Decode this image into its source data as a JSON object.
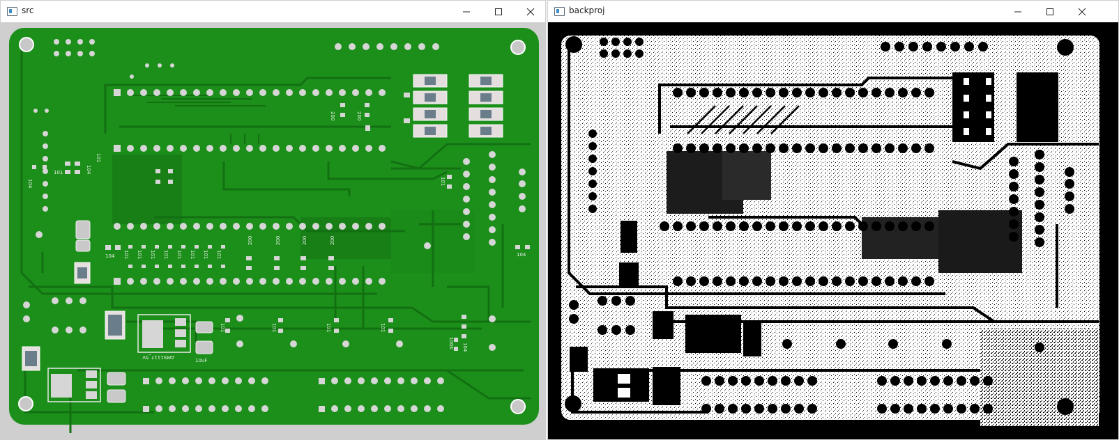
{
  "windows": {
    "src": {
      "title": "src",
      "silkscreen": {
        "cap1": "104",
        "cap2": "104",
        "cap3": "101",
        "cap4": "104",
        "res_row": [
          "101",
          "101",
          "101",
          "101",
          "101",
          "101",
          "101",
          "101"
        ],
        "res200": [
          "200",
          "200",
          "200",
          "200"
        ],
        "reg": "AMS1117_5V",
        "cap10u": "10uF",
        "cap_r1": "101",
        "cap_r2": "101",
        "cap_r3": "101",
        "cap_r4": "101",
        "side_cap": "104",
        "side_cap2": "101",
        "res_k": "100K",
        "cap_m": "104",
        "vert1": "101",
        "vert2": "200",
        "vert3": "200"
      },
      "colors": {
        "board": "#1c8f1a",
        "trace": "#167a15",
        "pad": "#d9d9d9",
        "frame": "#cfcfcf"
      }
    },
    "backproj": {
      "title": "backproj",
      "colors": {
        "background": "#000000",
        "foreground": "#ffffff"
      }
    }
  }
}
